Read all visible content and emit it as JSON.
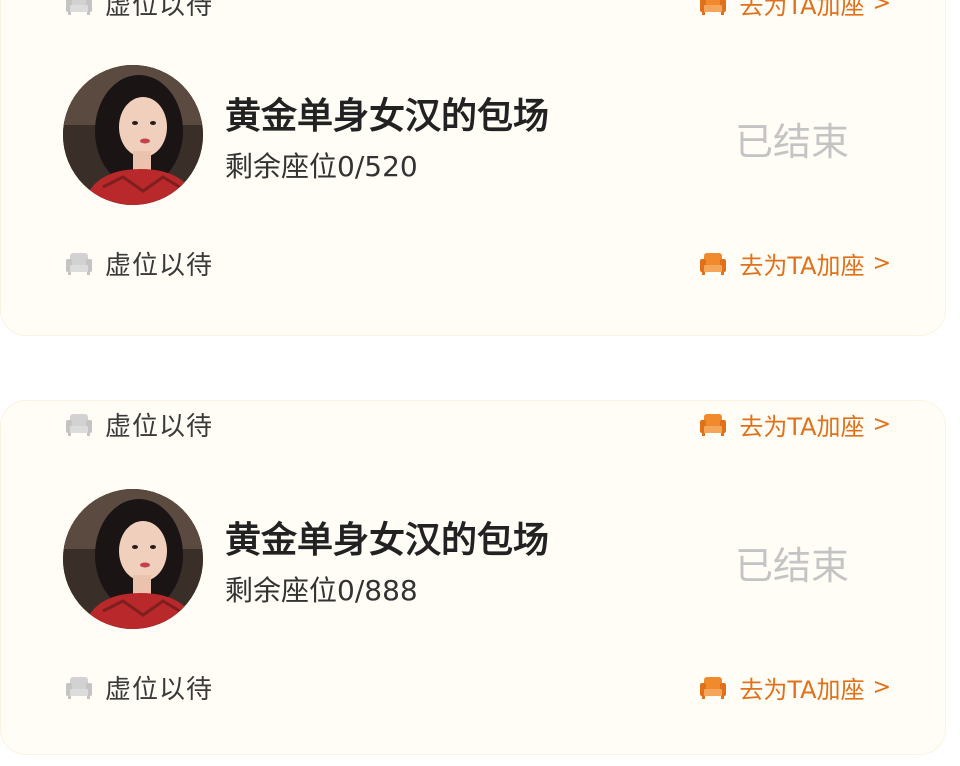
{
  "colors": {
    "accent": "#e0711a",
    "card_background": "#fffdf6",
    "ended_gray": "#c4c4c4",
    "icon_gray": "#c9c9c9"
  },
  "icons": {
    "seat_waiting": "sofa-icon",
    "seat_add": "sofa-icon",
    "chevron": "chevron-right-icon"
  },
  "cards": [
    {
      "top_row": {
        "left_text": "虚位以待",
        "right_text": "去为TA加座",
        "chevron": ">"
      },
      "session": {
        "title": "黄金单身女汉的包场",
        "remaining": "剩余座位0/520",
        "status": "已结束"
      },
      "bottom_row": {
        "left_text": "虚位以待",
        "right_text": "去为TA加座",
        "chevron": ">"
      }
    },
    {
      "top_row": {
        "left_text": "虚位以待",
        "right_text": "去为TA加座",
        "chevron": ">"
      },
      "session": {
        "title": "黄金单身女汉的包场",
        "remaining": "剩余座位0/888",
        "status": "已结束"
      },
      "bottom_row": {
        "left_text": "虚位以待",
        "right_text": "去为TA加座",
        "chevron": ">"
      }
    }
  ]
}
